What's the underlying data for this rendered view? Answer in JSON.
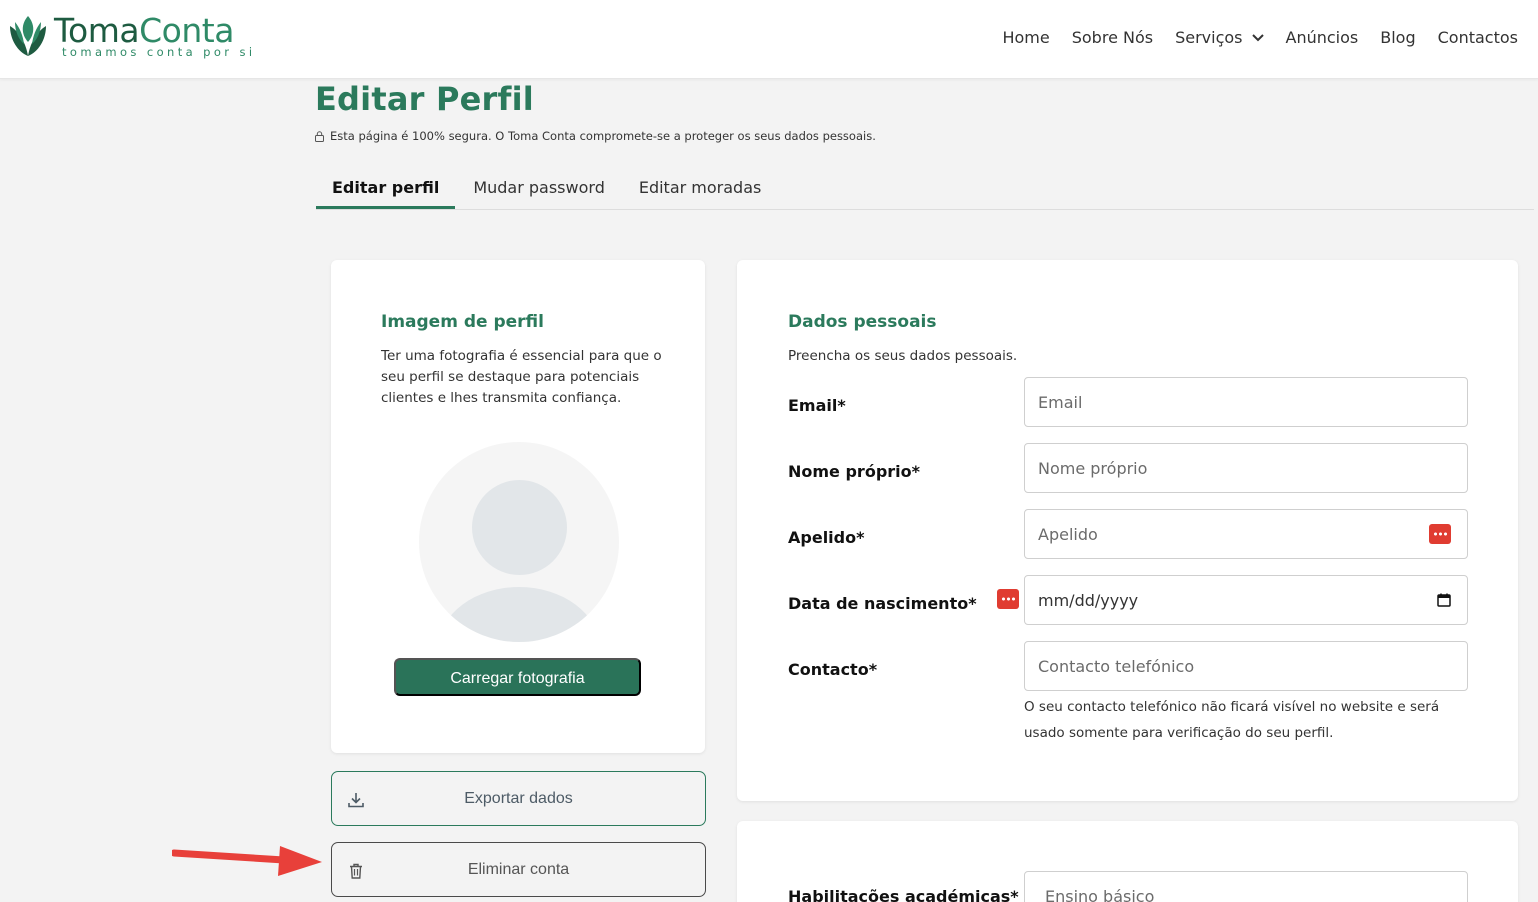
{
  "header": {
    "brand_part1": "Toma",
    "brand_part2": "Conta",
    "tagline": "tomamos conta por si",
    "nav": {
      "home": "Home",
      "about": "Sobre Nós",
      "services": "Serviços",
      "ads": "Anúncios",
      "blog": "Blog",
      "contacts": "Contactos"
    }
  },
  "page": {
    "title": "Editar Perfil",
    "secure_note": "Esta página é 100% segura. O Toma Conta compromete-se a proteger os seus dados pessoais."
  },
  "tabs": {
    "edit_profile": "Editar perfil",
    "change_password": "Mudar password",
    "edit_addresses": "Editar moradas"
  },
  "profile_card": {
    "title": "Imagem de perfil",
    "description": "Ter uma fotografia é essencial para que o seu perfil se destaque para potenciais clientes e lhes transmita confiança.",
    "upload_label": "Carregar fotografia"
  },
  "actions": {
    "export_label": "Exportar dados",
    "delete_label": "Eliminar conta"
  },
  "personal_data": {
    "title": "Dados pessoais",
    "subtitle": "Preencha os seus dados pessoais.",
    "email": {
      "label": "Email*",
      "placeholder": "Email"
    },
    "first_name": {
      "label": "Nome próprio*",
      "placeholder": "Nome próprio"
    },
    "last_name": {
      "label": "Apelido*",
      "placeholder": "Apelido"
    },
    "birth_date": {
      "label": "Data de nascimento*",
      "placeholder": "mm/dd/yyyy"
    },
    "contact": {
      "label": "Contacto*",
      "placeholder": "Contacto telefónico"
    },
    "contact_help": "O seu contacto telefónico não ficará visível no website e será usado somente para verificação do seu perfil."
  },
  "education": {
    "label": "Habilitações académicas*",
    "selected": "Ensino básico"
  },
  "colors": {
    "brand_green": "#2b7a5c",
    "button_green": "#2a7359",
    "alert_red": "#e03c31"
  }
}
